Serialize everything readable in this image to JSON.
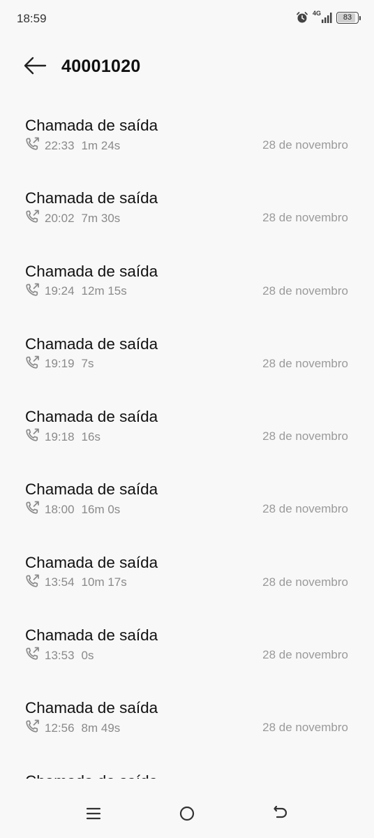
{
  "status_bar": {
    "time": "18:59",
    "network": "4G",
    "battery": "83",
    "icons": [
      "alarm-icon",
      "signal-icon",
      "battery-icon"
    ]
  },
  "header": {
    "title": "40001020",
    "back_icon": "arrow-left-icon"
  },
  "calls": [
    {
      "type": "Chamada de saída",
      "time": "22:33",
      "duration": "1m 24s",
      "date": "28 de novembro"
    },
    {
      "type": "Chamada de saída",
      "time": "20:02",
      "duration": "7m 30s",
      "date": "28 de novembro"
    },
    {
      "type": "Chamada de saída",
      "time": "19:24",
      "duration": "12m 15s",
      "date": "28 de novembro"
    },
    {
      "type": "Chamada de saída",
      "time": "19:19",
      "duration": "7s",
      "date": "28 de novembro"
    },
    {
      "type": "Chamada de saída",
      "time": "19:18",
      "duration": "16s",
      "date": "28 de novembro"
    },
    {
      "type": "Chamada de saída",
      "time": "18:00",
      "duration": "16m 0s",
      "date": "28 de novembro"
    },
    {
      "type": "Chamada de saída",
      "time": "13:54",
      "duration": "10m 17s",
      "date": "28 de novembro"
    },
    {
      "type": "Chamada de saída",
      "time": "13:53",
      "duration": "0s",
      "date": "28 de novembro"
    },
    {
      "type": "Chamada de saída",
      "time": "12:56",
      "duration": "8m 49s",
      "date": "28 de novembro"
    },
    {
      "type": "Chamada de saída",
      "time": "",
      "duration": "",
      "date": ""
    }
  ],
  "nav_bar": {
    "icons": [
      "menu-icon",
      "home-icon",
      "back-icon"
    ]
  },
  "colors": {
    "background": "#f8f8f8",
    "primary_text": "#111111",
    "secondary_text": "#8a8a8a"
  }
}
